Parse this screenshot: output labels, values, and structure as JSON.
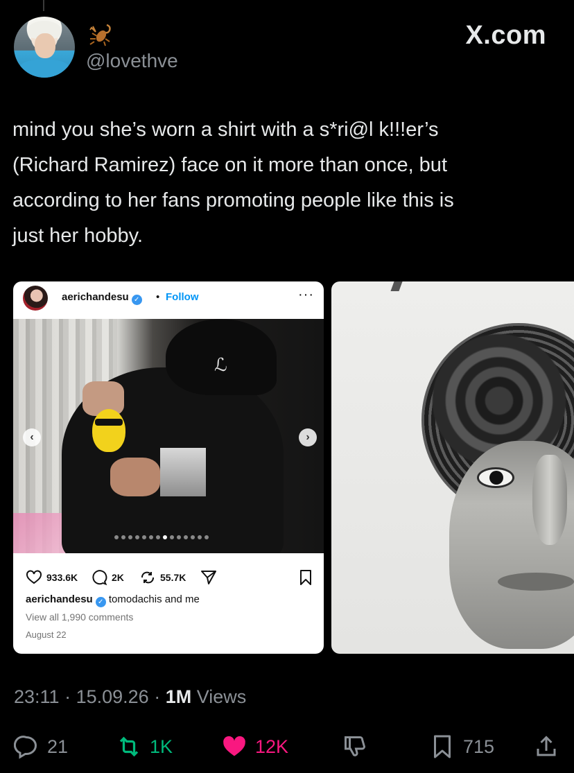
{
  "brand": "X.com",
  "author": {
    "handle": "@lovethve"
  },
  "tweet": {
    "lines": [
      "mind you she’s worn a shirt with a s*ri@l k!!!er’s",
      "(Richard Ramirez) face on it more than once, but",
      "according to her fans promoting people like this is",
      "just her hobby."
    ]
  },
  "instagram": {
    "username": "aerichandesu",
    "separator": "•",
    "follow_label": "Follow",
    "more": "···",
    "prev": "‹",
    "next": "›",
    "likes": "933.6K",
    "comments_count": "2K",
    "reposts": "55.7K",
    "caption_user": "aerichandesu",
    "caption": "tomodachis and me",
    "view_comments": "View all 1,990 comments",
    "date": "August 22",
    "carousel": {
      "total": 14,
      "active": 8
    }
  },
  "meta": {
    "time": "23:11",
    "date": "15.09.26",
    "views_count": "1M",
    "views_label": "Views",
    "sep": "·"
  },
  "actions": {
    "replies": "21",
    "reposts": "1K",
    "likes": "12K",
    "bookmarks": "715"
  },
  "colors": {
    "background": "#000000",
    "text": "#e7e9ea",
    "muted": "#8b9096",
    "repost": "#00ba7c",
    "like": "#f91880",
    "ig_link": "#0095f6"
  }
}
